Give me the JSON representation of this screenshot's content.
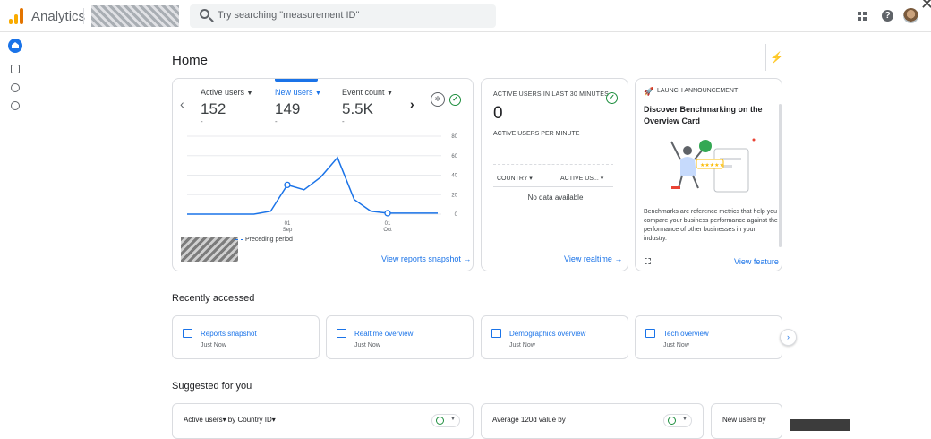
{
  "app": {
    "title": "Analytics"
  },
  "search": {
    "placeholder": "Try searching \"measurement ID\""
  },
  "page": {
    "title": "Home"
  },
  "snapshot": {
    "metrics": [
      {
        "label": "Active users",
        "value": "152",
        "sub": "-"
      },
      {
        "label": "New users",
        "value": "149",
        "sub": "-"
      },
      {
        "label": "Event count",
        "value": "5.5K",
        "sub": "-"
      }
    ],
    "x_ticks": [
      {
        "day": "01",
        "month": "Sep"
      },
      {
        "day": "01",
        "month": "Oct"
      }
    ],
    "legend_preceding": "Preceding period",
    "link": "View reports snapshot →"
  },
  "chart_data": {
    "type": "line",
    "ylim": [
      0,
      80
    ],
    "y_ticks": [
      "80",
      "60",
      "40",
      "20",
      "0"
    ],
    "series": [
      {
        "values": [
          0,
          0,
          0,
          0,
          0,
          3,
          30,
          25,
          38,
          58,
          15,
          3,
          1,
          1,
          1,
          1
        ]
      }
    ],
    "markers": [
      6,
      12
    ]
  },
  "realtime": {
    "title": "ACTIVE USERS IN LAST 30 MINUTES",
    "value": "0",
    "subtitle": "ACTIVE USERS PER MINUTE",
    "col_country": "COUNTRY ▾",
    "col_users": "ACTIVE US... ▾",
    "no_data": "No data available",
    "link": "View realtime →"
  },
  "announcement": {
    "kicker": "LAUNCH ANNOUNCEMENT",
    "title": "Discover Benchmarking on the Overview Card",
    "body": "Benchmarks are reference metrics that help you compare your business performance against the performance of other businesses in your industry.",
    "link": "View feature"
  },
  "recent": {
    "title": "Recently accessed",
    "items": [
      {
        "title": "Reports snapshot",
        "sub": "Just Now"
      },
      {
        "title": "Realtime overview",
        "sub": "Just Now"
      },
      {
        "title": "Demographics overview",
        "sub": "Just Now"
      },
      {
        "title": "Tech overview",
        "sub": "Just Now"
      }
    ]
  },
  "suggested": {
    "title": "Suggested for you",
    "cards": [
      {
        "title": "Active users▾ by Country ID▾"
      },
      {
        "title": "Average 120d value by"
      },
      {
        "title": "New users by"
      }
    ]
  },
  "colors": {
    "accent": "#1a73e8",
    "success": "#1e8e3e",
    "logo_orange": "#f9ab00",
    "logo_dark": "#e37400"
  }
}
